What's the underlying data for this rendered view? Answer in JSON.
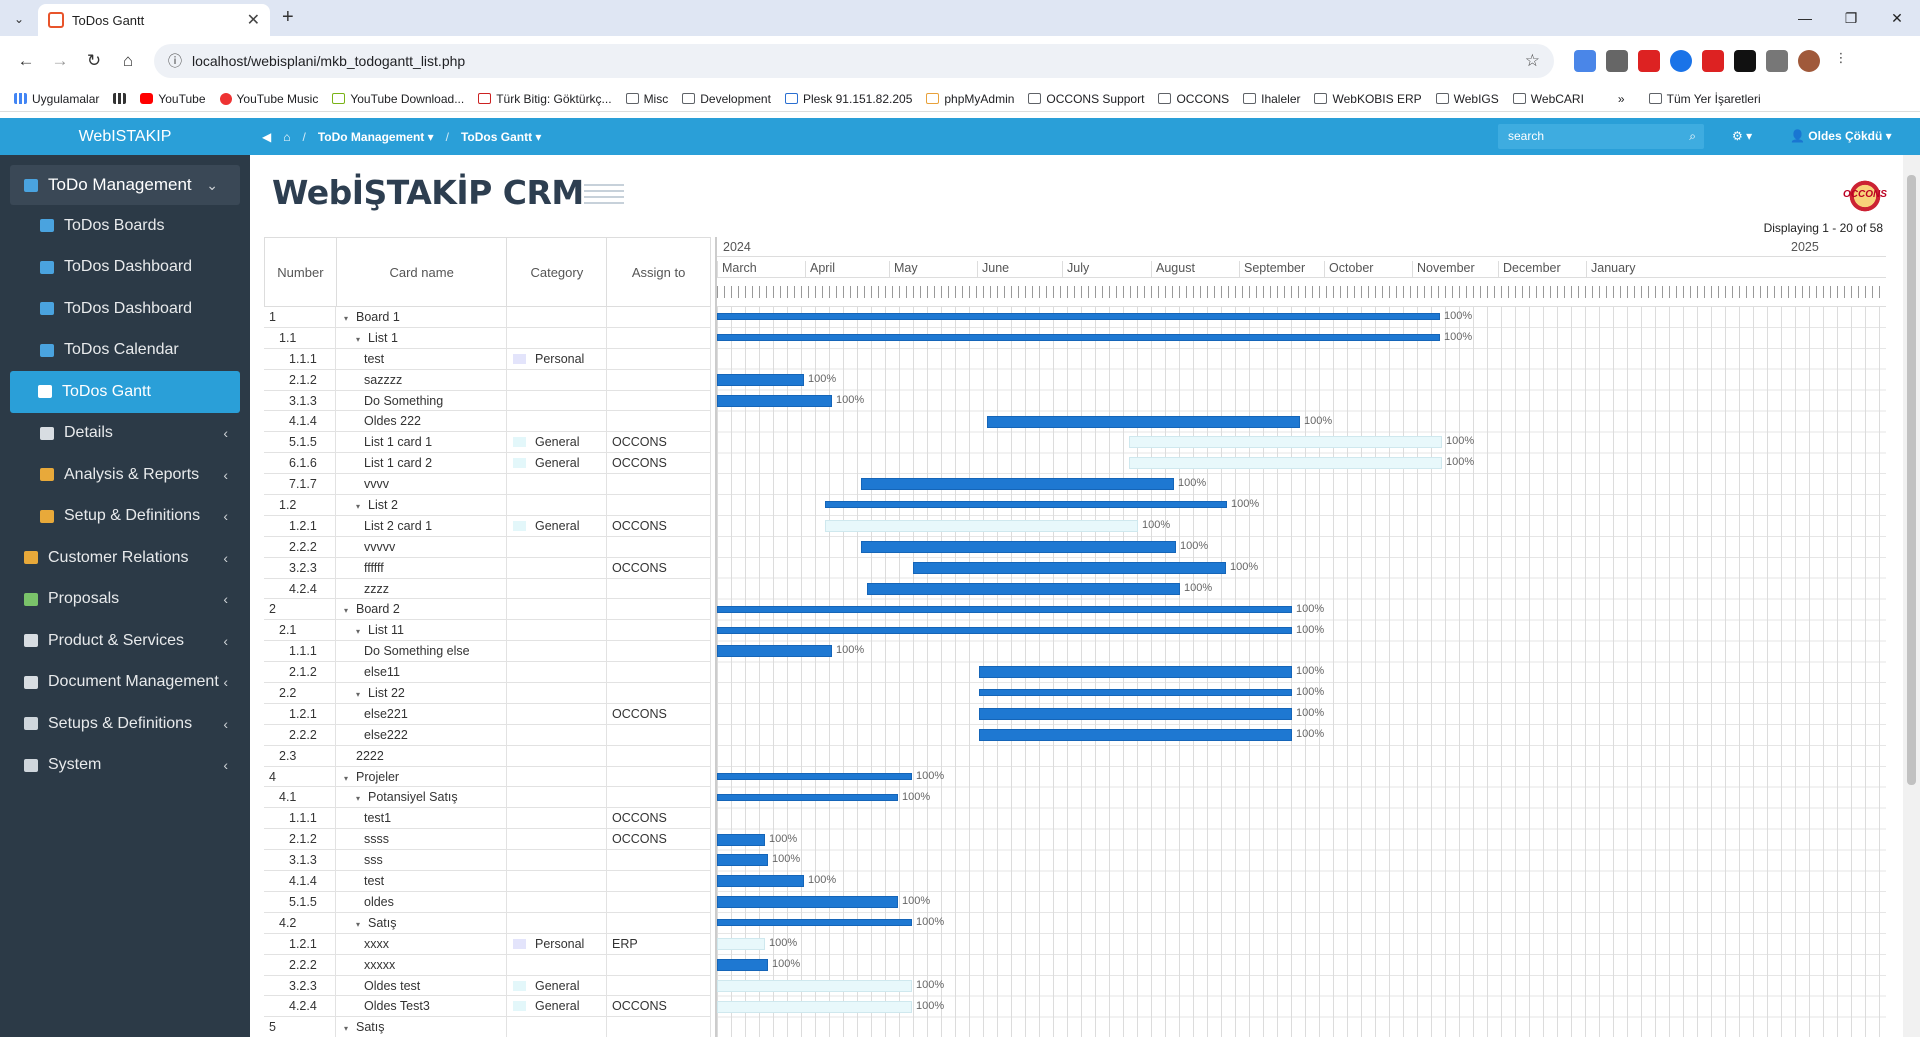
{
  "browser": {
    "tab_title": "ToDos Gantt",
    "url": "localhost/webisplani/mkb_todogantt_list.php",
    "bookmarks": [
      "Uygulamalar",
      "YouTube",
      "YouTube Music",
      "YouTube Download...",
      "Türk Bitig: Göktürkç...",
      "Misc",
      "Development",
      "Plesk 91.151.82.205",
      "phpMyAdmin",
      "OCCONS Support",
      "OCCONS",
      "Ihaleler",
      "WebKOBIS ERP",
      "WebIGS",
      "WebCARI",
      "Tüm Yer İşaretleri"
    ]
  },
  "sidebar": {
    "brand": "WebISTAKIP",
    "items": [
      {
        "label": "ToDo Management",
        "icon": "grid-icon",
        "open": true
      },
      {
        "label": "ToDos Boards",
        "icon": "grid-icon",
        "sub": true
      },
      {
        "label": "ToDos Dashboard",
        "icon": "grid-icon",
        "sub": true
      },
      {
        "label": "ToDos Dashboard",
        "icon": "grid-icon",
        "sub": true
      },
      {
        "label": "ToDos Calendar",
        "icon": "calendar-icon",
        "sub": true
      },
      {
        "label": "ToDos Gantt",
        "icon": "gantt-icon",
        "sub": true,
        "active": true
      },
      {
        "label": "Details",
        "icon": "details-icon",
        "sub": true,
        "chev": true
      },
      {
        "label": "Analysis & Reports",
        "icon": "chart-icon",
        "sub": true,
        "chev": true
      },
      {
        "label": "Setup & Definitions",
        "icon": "wrench-icon",
        "sub": true,
        "chev": true
      },
      {
        "label": "Customer Relations",
        "icon": "people-icon",
        "chev": true
      },
      {
        "label": "Proposals",
        "icon": "proposal-icon",
        "chev": true
      },
      {
        "label": "Product & Services",
        "icon": "product-icon",
        "chev": true
      },
      {
        "label": "Document Management",
        "icon": "document-icon",
        "chev": true
      },
      {
        "label": "Setups & Definitions",
        "icon": "tools-icon",
        "chev": true
      },
      {
        "label": "System",
        "icon": "tools-icon",
        "chev": true
      }
    ]
  },
  "topbar": {
    "crumb1": "ToDo Management",
    "crumb2": "ToDos Gantt",
    "search_placeholder": "search",
    "user": "Oldes Çökdü"
  },
  "page": {
    "logo": "WebİŞTAKİP CRM",
    "corner_logo": "OCCONS",
    "displaying": "Displaying 1 - 20 of 58"
  },
  "grid": {
    "headers": {
      "number": "Number",
      "name": "Card name",
      "category": "Category",
      "assign": "Assign to"
    },
    "years": [
      "2024",
      "2025"
    ],
    "months": [
      "March",
      "April",
      "May",
      "June",
      "July",
      "August",
      "September",
      "October",
      "November",
      "December",
      "January"
    ],
    "rows": [
      {
        "num": "1",
        "lvl": 0,
        "name": "Board 1",
        "tri": true,
        "bar": [
          0,
          723
        ],
        "pct": "100%",
        "parent": true
      },
      {
        "num": "1.1",
        "lvl": 1,
        "name": "List 1",
        "tri": true,
        "bar": [
          0,
          723
        ],
        "pct": "100%",
        "parent": true
      },
      {
        "num": "1.1.1",
        "lvl": 2,
        "name": "test",
        "cat": "Personal",
        "catColor": "#e3e4fb"
      },
      {
        "num": "2.1.2",
        "lvl": 2,
        "name": "sazzzz",
        "bar": [
          0,
          87
        ],
        "pct": "100%"
      },
      {
        "num": "3.1.3",
        "lvl": 2,
        "name": "Do Something",
        "bar": [
          0,
          115
        ],
        "pct": "100%"
      },
      {
        "num": "4.1.4",
        "lvl": 2,
        "name": "Oldes 222",
        "bar": [
          270,
          313
        ],
        "pct": "100%"
      },
      {
        "num": "5.1.5",
        "lvl": 2,
        "name": "List 1 card 1",
        "cat": "General",
        "catColor": "#e3f7fa",
        "asg": "OCCONS",
        "bar": [
          412,
          313
        ],
        "pct": "100%",
        "light": true
      },
      {
        "num": "6.1.6",
        "lvl": 2,
        "name": "List 1 card 2",
        "cat": "General",
        "catColor": "#e3f7fa",
        "asg": "OCCONS",
        "bar": [
          412,
          313
        ],
        "pct": "100%",
        "light": true
      },
      {
        "num": "7.1.7",
        "lvl": 2,
        "name": "vvvv",
        "bar": [
          144,
          313
        ],
        "pct": "100%"
      },
      {
        "num": "1.2",
        "lvl": 1,
        "name": "List 2",
        "tri": true,
        "bar": [
          108,
          402
        ],
        "pct": "100%",
        "parent": true
      },
      {
        "num": "1.2.1",
        "lvl": 2,
        "name": "List 2 card 1",
        "cat": "General",
        "catColor": "#e3f7fa",
        "asg": "OCCONS",
        "bar": [
          108,
          313
        ],
        "pct": "100%",
        "light": true
      },
      {
        "num": "2.2.2",
        "lvl": 2,
        "name": "vvvvv",
        "bar": [
          144,
          315
        ],
        "pct": "100%"
      },
      {
        "num": "3.2.3",
        "lvl": 2,
        "name": "ffffff",
        "asg": "OCCONS",
        "bar": [
          196,
          313
        ],
        "pct": "100%"
      },
      {
        "num": "4.2.4",
        "lvl": 2,
        "name": "zzzz",
        "bar": [
          150,
          313
        ],
        "pct": "100%"
      },
      {
        "num": "2",
        "lvl": 0,
        "name": "Board 2",
        "tri": true,
        "bar": [
          0,
          575
        ],
        "pct": "100%",
        "parent": true
      },
      {
        "num": "2.1",
        "lvl": 1,
        "name": "List 11",
        "tri": true,
        "bar": [
          0,
          575
        ],
        "pct": "100%",
        "parent": true
      },
      {
        "num": "1.1.1",
        "lvl": 2,
        "name": "Do Something else",
        "bar": [
          0,
          115
        ],
        "pct": "100%"
      },
      {
        "num": "2.1.2",
        "lvl": 2,
        "name": "else11",
        "bar": [
          262,
          313
        ],
        "pct": "100%"
      },
      {
        "num": "2.2",
        "lvl": 1,
        "name": "List 22",
        "tri": true,
        "bar": [
          262,
          313
        ],
        "pct": "100%",
        "parent": true
      },
      {
        "num": "1.2.1",
        "lvl": 2,
        "name": "else221",
        "asg": "OCCONS",
        "bar": [
          262,
          313
        ],
        "pct": "100%"
      },
      {
        "num": "2.2.2",
        "lvl": 2,
        "name": "else222",
        "bar": [
          262,
          313
        ],
        "pct": "100%"
      },
      {
        "num": "2.3",
        "lvl": 1,
        "name": "2222"
      },
      {
        "num": "4",
        "lvl": 0,
        "name": "Projeler",
        "tri": true,
        "bar": [
          0,
          195
        ],
        "pct": "100%",
        "parent": true
      },
      {
        "num": "4.1",
        "lvl": 1,
        "name": "Potansiyel Satış",
        "tri": true,
        "bar": [
          0,
          181
        ],
        "pct": "100%",
        "parent": true
      },
      {
        "num": "1.1.1",
        "lvl": 2,
        "name": "test1",
        "asg": "OCCONS"
      },
      {
        "num": "2.1.2",
        "lvl": 2,
        "name": "ssss",
        "asg": "OCCONS",
        "bar": [
          0,
          48
        ],
        "pct": "100%"
      },
      {
        "num": "3.1.3",
        "lvl": 2,
        "name": "sss",
        "bar": [
          0,
          51
        ],
        "pct": "100%"
      },
      {
        "num": "4.1.4",
        "lvl": 2,
        "name": "test",
        "bar": [
          0,
          87
        ],
        "pct": "100%"
      },
      {
        "num": "5.1.5",
        "lvl": 2,
        "name": "oldes",
        "bar": [
          0,
          181
        ],
        "pct": "100%"
      },
      {
        "num": "4.2",
        "lvl": 1,
        "name": "Satış",
        "tri": true,
        "bar": [
          0,
          195
        ],
        "pct": "100%",
        "parent": true
      },
      {
        "num": "1.2.1",
        "lvl": 2,
        "name": "xxxx",
        "cat": "Personal",
        "catColor": "#e3e4fb",
        "asg": "ERP",
        "bar": [
          0,
          48
        ],
        "pct": "100%",
        "light": true
      },
      {
        "num": "2.2.2",
        "lvl": 2,
        "name": "xxxxx",
        "bar": [
          0,
          51
        ],
        "pct": "100%"
      },
      {
        "num": "3.2.3",
        "lvl": 2,
        "name": "Oldes test",
        "cat": "General",
        "catColor": "#e3f7fa",
        "bar": [
          0,
          195
        ],
        "pct": "100%",
        "light": true
      },
      {
        "num": "4.2.4",
        "lvl": 2,
        "name": "Oldes Test3",
        "cat": "General",
        "catColor": "#e3f7fa",
        "asg": "OCCONS",
        "bar": [
          0,
          195
        ],
        "pct": "100%",
        "light": true
      },
      {
        "num": "5",
        "lvl": 0,
        "name": "Satış",
        "tri": true
      }
    ]
  }
}
